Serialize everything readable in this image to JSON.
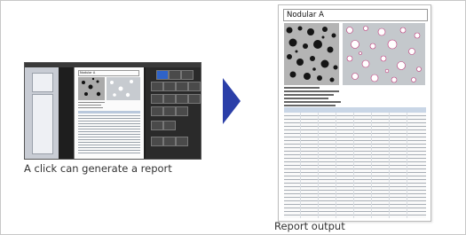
{
  "left_caption": "A click can generate a report",
  "right_caption": "Report output",
  "screenshot": {
    "document_title": "Nodular A"
  },
  "report": {
    "title": "Nodular A"
  },
  "colors": {
    "arrow": "#2b3fa8",
    "accent": "#2f63c8"
  },
  "icons": {
    "arrow": "right-arrow-icon"
  }
}
